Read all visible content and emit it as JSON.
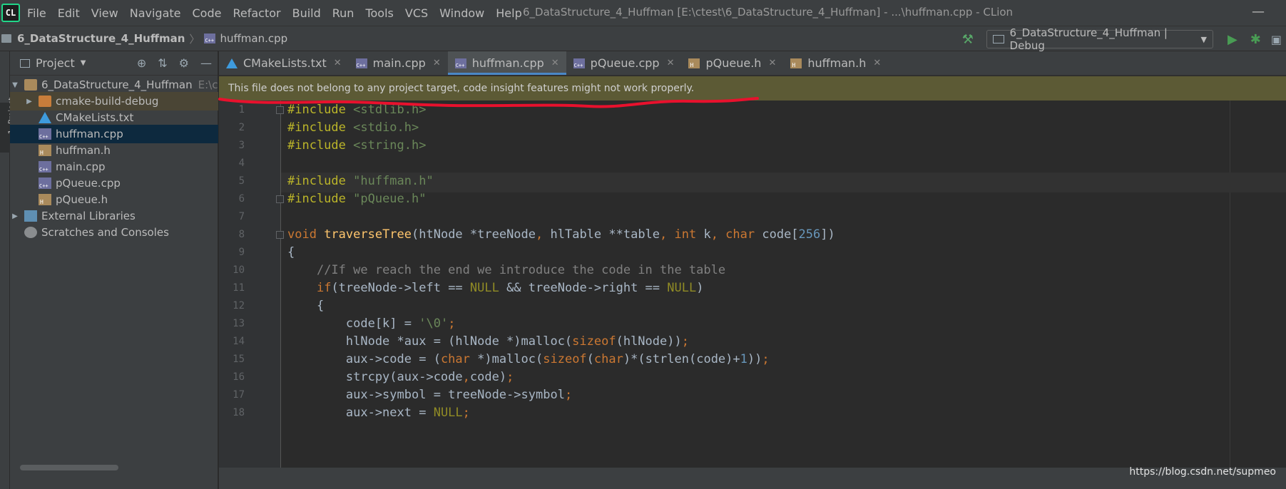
{
  "app": {
    "window_title": "6_DataStructure_4_Huffman [E:\\ctest\\6_DataStructure_4_Huffman] - ...\\huffman.cpp - CLion",
    "logo_text": "CL"
  },
  "menu": [
    "File",
    "Edit",
    "View",
    "Navigate",
    "Code",
    "Refactor",
    "Build",
    "Run",
    "Tools",
    "VCS",
    "Window",
    "Help"
  ],
  "navbar": {
    "project": "6_DataStructure_4_Huffman",
    "file": "huffman.cpp",
    "run_config": "6_DataStructure_4_Huffman | Debug"
  },
  "tool_strip": {
    "label": "1: Project"
  },
  "project_panel": {
    "title": "Project",
    "tree": [
      {
        "label": "6_DataStructure_4_Huffman",
        "hint": "E:\\c",
        "icon": "folder-icon"
      },
      {
        "label": "cmake-build-debug",
        "icon": "folder-icon"
      },
      {
        "label": "CMakeLists.txt",
        "icon": "cmake-icon"
      },
      {
        "label": "huffman.cpp",
        "icon": "cpp-file-icon"
      },
      {
        "label": "huffman.h",
        "icon": "header-file-icon"
      },
      {
        "label": "main.cpp",
        "icon": "cpp-file-icon"
      },
      {
        "label": "pQueue.cpp",
        "icon": "cpp-file-icon"
      },
      {
        "label": "pQueue.h",
        "icon": "header-file-icon"
      },
      {
        "label": "External Libraries",
        "icon": "library-icon"
      },
      {
        "label": "Scratches and Consoles",
        "icon": "scratch-icon"
      }
    ]
  },
  "tabs": [
    {
      "label": "CMakeLists.txt",
      "icon": "cmake-icon"
    },
    {
      "label": "main.cpp",
      "icon": "cpp-file-icon"
    },
    {
      "label": "huffman.cpp",
      "icon": "cpp-file-icon",
      "active": true
    },
    {
      "label": "pQueue.cpp",
      "icon": "cpp-file-icon"
    },
    {
      "label": "pQueue.h",
      "icon": "header-file-icon"
    },
    {
      "label": "huffman.h",
      "icon": "header-file-icon"
    }
  ],
  "banner": {
    "text": "This file does not belong to any project target, code insight features might not work properly.",
    "annotation_color": "#e8112d"
  },
  "editor": {
    "line_numbers": [
      "1",
      "2",
      "3",
      "4",
      "5",
      "6",
      "7",
      "8",
      "9",
      "10",
      "11",
      "12",
      "13",
      "14",
      "15",
      "16",
      "17",
      "18"
    ],
    "current_line": 5,
    "lines": [
      [
        [
          "pp",
          "#include "
        ],
        [
          "hdr",
          "<stdlib.h>"
        ]
      ],
      [
        [
          "pp",
          "#include "
        ],
        [
          "hdr",
          "<stdio.h>"
        ]
      ],
      [
        [
          "pp",
          "#include "
        ],
        [
          "hdr",
          "<string.h>"
        ]
      ],
      [],
      [
        [
          "pp",
          "#include "
        ],
        [
          "str",
          "\"huffman.h\""
        ]
      ],
      [
        [
          "pp",
          "#include "
        ],
        [
          "str",
          "\"pQueue.h\""
        ]
      ],
      [],
      [
        [
          "kw",
          "void "
        ],
        [
          "fn",
          "traverseTree"
        ],
        [
          "pl",
          "(htNode *treeNode"
        ],
        [
          "kw",
          ", "
        ],
        [
          "pl",
          "hlTable **table"
        ],
        [
          "kw",
          ", int "
        ],
        [
          "pl",
          "k"
        ],
        [
          "kw",
          ", char "
        ],
        [
          "pl",
          "code["
        ],
        [
          "num",
          "256"
        ],
        [
          "pl",
          "])"
        ]
      ],
      [
        [
          "pl",
          "{"
        ]
      ],
      [
        [
          "pl",
          "    "
        ],
        [
          "cm",
          "//If we reach the end we introduce the code in the table"
        ]
      ],
      [
        [
          "pl",
          "    "
        ],
        [
          "kw",
          "if"
        ],
        [
          "pl",
          "(treeNode->left == "
        ],
        [
          "macro",
          "NULL"
        ],
        [
          "pl",
          " && treeNode->right == "
        ],
        [
          "macro",
          "NULL"
        ],
        [
          "pl",
          ")"
        ]
      ],
      [
        [
          "pl",
          "    {"
        ]
      ],
      [
        [
          "pl",
          "        code[k] = "
        ],
        [
          "str",
          "'\\0'"
        ],
        [
          "kw",
          ";"
        ]
      ],
      [
        [
          "pl",
          "        hlNode *aux = (hlNode *)malloc("
        ],
        [
          "kw",
          "sizeof"
        ],
        [
          "pl",
          "(hlNode))"
        ],
        [
          "kw",
          ";"
        ]
      ],
      [
        [
          "pl",
          "        aux->code = ("
        ],
        [
          "kw",
          "char "
        ],
        [
          "pl",
          "*)malloc("
        ],
        [
          "kw",
          "sizeof"
        ],
        [
          "pl",
          "("
        ],
        [
          "kw",
          "char"
        ],
        [
          "pl",
          ")*(strlen(code)+"
        ],
        [
          "num",
          "1"
        ],
        [
          "pl",
          "))"
        ],
        [
          "kw",
          ";"
        ]
      ],
      [
        [
          "pl",
          "        strcpy(aux->code"
        ],
        [
          "kw",
          ","
        ],
        [
          "pl",
          "code)"
        ],
        [
          "kw",
          ";"
        ]
      ],
      [
        [
          "pl",
          "        aux->symbol = treeNode->symbol"
        ],
        [
          "kw",
          ";"
        ]
      ],
      [
        [
          "pl",
          "        aux->next = "
        ],
        [
          "macro",
          "NULL"
        ],
        [
          "kw",
          ";"
        ]
      ]
    ]
  },
  "watermark": "https://blog.csdn.net/supmeo"
}
